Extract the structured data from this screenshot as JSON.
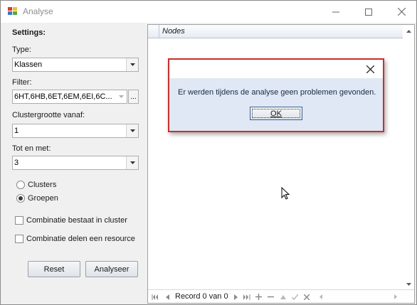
{
  "window": {
    "title": "Analyse"
  },
  "settings": {
    "heading": "Settings:",
    "type_label": "Type:",
    "type_value": "Klassen",
    "filter_label": "Filter:",
    "filter_value": "6HT,6HB,6ET,6EM,6EI,6C...",
    "filter_button": "...",
    "cluster_from_label": "Clustergrootte vanaf:",
    "cluster_from_value": "1",
    "to_label": "Tot en met:",
    "to_value": "3",
    "radio_clusters": "Clusters",
    "radio_groups": "Groepen",
    "radio_selected": "Groepen",
    "check_cluster": "Combinatie bestaat in cluster",
    "check_resource": "Combinatie delen een resource",
    "reset_button": "Reset",
    "analyse_button": "Analyseer"
  },
  "grid": {
    "column_header": "Nodes",
    "navigator_text": "Record 0 van 0"
  },
  "dialog": {
    "message": "Er werden tijdens de analyse geen problemen gevonden.",
    "ok_button": "OK"
  },
  "colors": {
    "dialog_border": "#c8302a",
    "dialog_background": "#dfe8f4"
  },
  "icons": [
    "app-icon",
    "minimize-icon",
    "maximize-icon",
    "close-icon",
    "chevron-down-icon",
    "scroll-up-icon",
    "scroll-down-icon",
    "first-record-icon",
    "prev-page-icon",
    "prev-record-icon",
    "next-record-icon",
    "next-page-icon",
    "last-record-icon",
    "add-record-icon",
    "delete-record-icon",
    "edit-record-icon",
    "save-record-icon",
    "cancel-record-icon",
    "mouse-cursor-icon"
  ]
}
